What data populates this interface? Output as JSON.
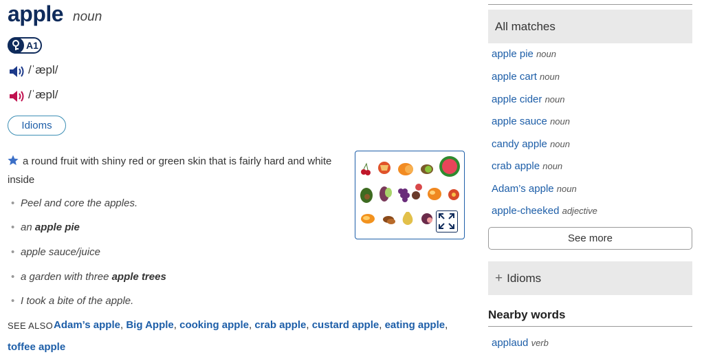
{
  "entry": {
    "headword": "apple",
    "part_of_speech": "noun",
    "level": "A1",
    "pron_uk": "/ˈæpl/",
    "pron_us": "/ˈæpl/",
    "idioms_button": "Idioms",
    "definition": "a round fruit with shiny red or green skin that is fairly hard and white inside",
    "examples": [
      {
        "pre": "Peel and core the apples.",
        "bold": "",
        "post": ""
      },
      {
        "pre": "an ",
        "bold": "apple pie",
        "post": ""
      },
      {
        "pre": "apple sauce/juice",
        "bold": "",
        "post": ""
      },
      {
        "pre": "a garden with three ",
        "bold": "apple trees",
        "post": ""
      },
      {
        "pre": "I took a bite of the apple.",
        "bold": "",
        "post": ""
      }
    ],
    "see_also_label": "SEE ALSO",
    "see_also": [
      "Adam’s apple",
      "Big Apple",
      "cooking apple",
      "crab apple",
      "custard apple",
      "eating apple",
      "toffee apple"
    ]
  },
  "sidebar": {
    "all_matches_title": "All matches",
    "matches": [
      {
        "word": "apple pie",
        "pos": "noun"
      },
      {
        "word": "apple cart",
        "pos": "noun"
      },
      {
        "word": "apple cider",
        "pos": "noun"
      },
      {
        "word": "apple sauce",
        "pos": "noun"
      },
      {
        "word": "candy apple",
        "pos": "noun"
      },
      {
        "word": "crab apple",
        "pos": "noun"
      },
      {
        "word": "Adam’s apple",
        "pos": "noun"
      },
      {
        "word": "apple-cheeked",
        "pos": "adjective"
      }
    ],
    "see_more": "See more",
    "idioms_title": "Idioms",
    "nearby_title": "Nearby words",
    "nearby": [
      {
        "word": "applaud",
        "pos": "verb"
      }
    ]
  },
  "colors": {
    "link": "#1d5ea8",
    "headword": "#0f2b5b",
    "uk_speaker": "#1d3a8a",
    "us_speaker": "#c0114f",
    "panel_bg": "#e9e9e9"
  }
}
